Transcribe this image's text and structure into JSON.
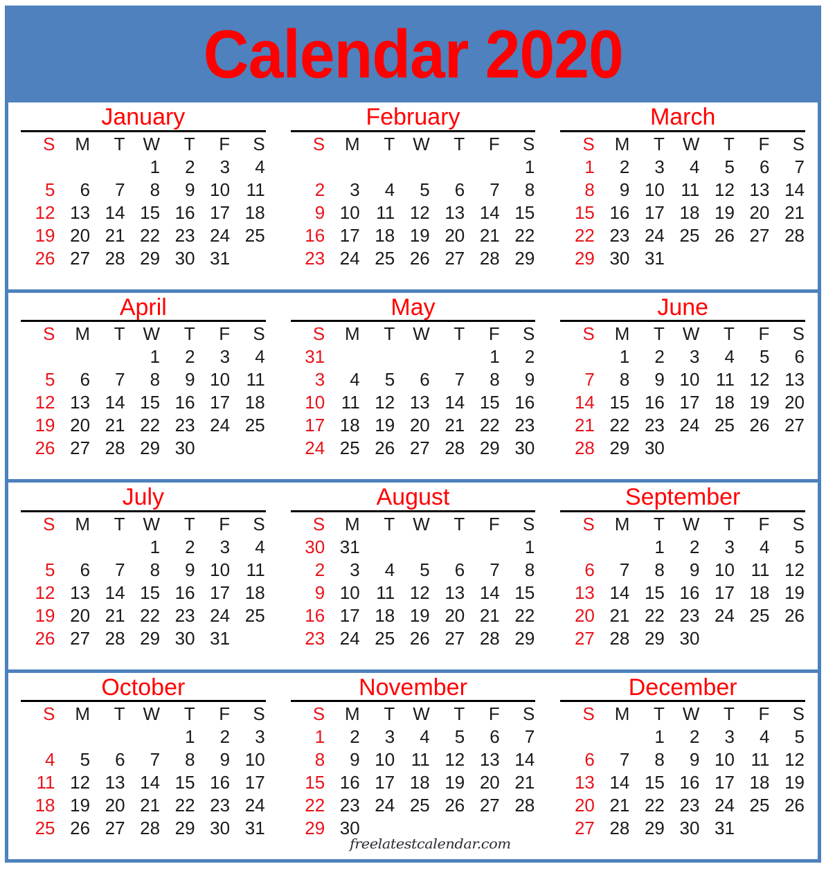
{
  "header": {
    "title": "Calendar 2020",
    "background_color": "#4e81bd",
    "title_color": "#ff0000"
  },
  "colors": {
    "border": "#4e81bd",
    "sunday": "#e8131a",
    "month_name": "#ff0000",
    "weekday": "#1a1a1a",
    "day_number": "#1a1a1a",
    "rule": "#000000",
    "page_background": "#ffffff"
  },
  "weekday_headers": [
    "S",
    "M",
    "T",
    "W",
    "T",
    "F",
    "S"
  ],
  "watermark": "freelatestcalendar.com",
  "months": [
    {
      "name": "January",
      "weeks": [
        [
          "",
          "",
          "",
          "1",
          "2",
          "3",
          "4"
        ],
        [
          "5",
          "6",
          "7",
          "8",
          "9",
          "10",
          "11"
        ],
        [
          "12",
          "13",
          "14",
          "15",
          "16",
          "17",
          "18"
        ],
        [
          "19",
          "20",
          "21",
          "22",
          "23",
          "24",
          "25"
        ],
        [
          "26",
          "27",
          "28",
          "29",
          "30",
          "31",
          ""
        ]
      ]
    },
    {
      "name": "February",
      "weeks": [
        [
          "",
          "",
          "",
          "",
          "",
          "",
          "1"
        ],
        [
          "2",
          "3",
          "4",
          "5",
          "6",
          "7",
          "8"
        ],
        [
          "9",
          "10",
          "11",
          "12",
          "13",
          "14",
          "15"
        ],
        [
          "16",
          "17",
          "18",
          "19",
          "20",
          "21",
          "22"
        ],
        [
          "23",
          "24",
          "25",
          "26",
          "27",
          "28",
          "29"
        ]
      ]
    },
    {
      "name": "March",
      "weeks": [
        [
          "1",
          "2",
          "3",
          "4",
          "5",
          "6",
          "7"
        ],
        [
          "8",
          "9",
          "10",
          "11",
          "12",
          "13",
          "14"
        ],
        [
          "15",
          "16",
          "17",
          "18",
          "19",
          "20",
          "21"
        ],
        [
          "22",
          "23",
          "24",
          "25",
          "26",
          "27",
          "28"
        ],
        [
          "29",
          "30",
          "31",
          "",
          "",
          "",
          ""
        ]
      ]
    },
    {
      "name": "April",
      "weeks": [
        [
          "",
          "",
          "",
          "1",
          "2",
          "3",
          "4"
        ],
        [
          "5",
          "6",
          "7",
          "8",
          "9",
          "10",
          "11"
        ],
        [
          "12",
          "13",
          "14",
          "15",
          "16",
          "17",
          "18"
        ],
        [
          "19",
          "20",
          "21",
          "22",
          "23",
          "24",
          "25"
        ],
        [
          "26",
          "27",
          "28",
          "29",
          "30",
          "",
          ""
        ]
      ]
    },
    {
      "name": "May",
      "weeks": [
        [
          "31",
          "",
          "",
          "",
          "",
          "1",
          "2"
        ],
        [
          "3",
          "4",
          "5",
          "6",
          "7",
          "8",
          "9"
        ],
        [
          "10",
          "11",
          "12",
          "13",
          "14",
          "15",
          "16"
        ],
        [
          "17",
          "18",
          "19",
          "20",
          "21",
          "22",
          "23"
        ],
        [
          "24",
          "25",
          "26",
          "27",
          "28",
          "29",
          "30"
        ]
      ]
    },
    {
      "name": "June",
      "weeks": [
        [
          "",
          "1",
          "2",
          "3",
          "4",
          "5",
          "6"
        ],
        [
          "7",
          "8",
          "9",
          "10",
          "11",
          "12",
          "13"
        ],
        [
          "14",
          "15",
          "16",
          "17",
          "18",
          "19",
          "20"
        ],
        [
          "21",
          "22",
          "23",
          "24",
          "25",
          "26",
          "27"
        ],
        [
          "28",
          "29",
          "30",
          "",
          "",
          "",
          ""
        ]
      ]
    },
    {
      "name": "July",
      "weeks": [
        [
          "",
          "",
          "",
          "1",
          "2",
          "3",
          "4"
        ],
        [
          "5",
          "6",
          "7",
          "8",
          "9",
          "10",
          "11"
        ],
        [
          "12",
          "13",
          "14",
          "15",
          "16",
          "17",
          "18"
        ],
        [
          "19",
          "20",
          "21",
          "22",
          "23",
          "24",
          "25"
        ],
        [
          "26",
          "27",
          "28",
          "29",
          "30",
          "31",
          ""
        ]
      ]
    },
    {
      "name": "August",
      "weeks": [
        [
          "30",
          "31",
          "",
          "",
          "",
          "",
          "1"
        ],
        [
          "2",
          "3",
          "4",
          "5",
          "6",
          "7",
          "8"
        ],
        [
          "9",
          "10",
          "11",
          "12",
          "13",
          "14",
          "15"
        ],
        [
          "16",
          "17",
          "18",
          "19",
          "20",
          "21",
          "22"
        ],
        [
          "23",
          "24",
          "25",
          "26",
          "27",
          "28",
          "29"
        ]
      ]
    },
    {
      "name": "September",
      "weeks": [
        [
          "",
          "",
          "1",
          "2",
          "3",
          "4",
          "5"
        ],
        [
          "6",
          "7",
          "8",
          "9",
          "10",
          "11",
          "12"
        ],
        [
          "13",
          "14",
          "15",
          "16",
          "17",
          "18",
          "19"
        ],
        [
          "20",
          "21",
          "22",
          "23",
          "24",
          "25",
          "26"
        ],
        [
          "27",
          "28",
          "29",
          "30",
          "",
          "",
          ""
        ]
      ]
    },
    {
      "name": "October",
      "weeks": [
        [
          "",
          "",
          "",
          "",
          "1",
          "2",
          "3"
        ],
        [
          "4",
          "5",
          "6",
          "7",
          "8",
          "9",
          "10"
        ],
        [
          "11",
          "12",
          "13",
          "14",
          "15",
          "16",
          "17"
        ],
        [
          "18",
          "19",
          "20",
          "21",
          "22",
          "23",
          "24"
        ],
        [
          "25",
          "26",
          "27",
          "28",
          "29",
          "30",
          "31"
        ]
      ]
    },
    {
      "name": "November",
      "weeks": [
        [
          "1",
          "2",
          "3",
          "4",
          "5",
          "6",
          "7"
        ],
        [
          "8",
          "9",
          "10",
          "11",
          "12",
          "13",
          "14"
        ],
        [
          "15",
          "16",
          "17",
          "18",
          "19",
          "20",
          "21"
        ],
        [
          "22",
          "23",
          "24",
          "25",
          "26",
          "27",
          "28"
        ],
        [
          "29",
          "30",
          "",
          "",
          "",
          "",
          ""
        ]
      ]
    },
    {
      "name": "December",
      "weeks": [
        [
          "",
          "",
          "1",
          "2",
          "3",
          "4",
          "5"
        ],
        [
          "6",
          "7",
          "8",
          "9",
          "10",
          "11",
          "12"
        ],
        [
          "13",
          "14",
          "15",
          "16",
          "17",
          "18",
          "19"
        ],
        [
          "20",
          "21",
          "22",
          "23",
          "24",
          "25",
          "26"
        ],
        [
          "27",
          "28",
          "29",
          "30",
          "31",
          "",
          ""
        ]
      ]
    }
  ]
}
